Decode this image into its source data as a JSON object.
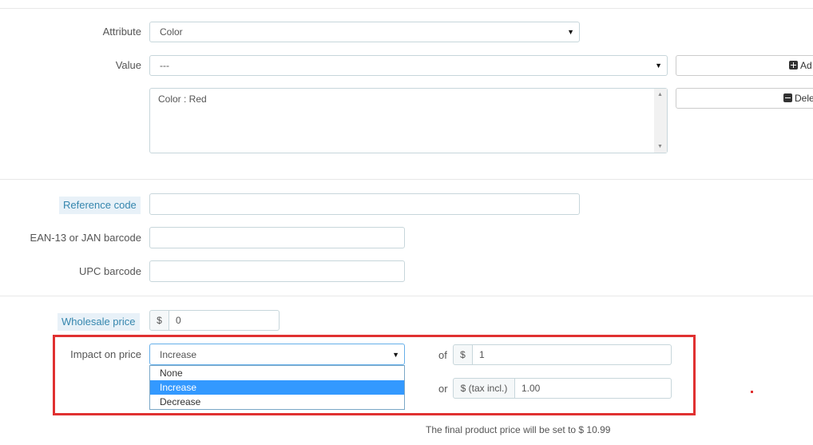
{
  "combination": {
    "attribute_label": "Attribute",
    "attribute_value": "Color",
    "value_label": "Value",
    "value_value": "---",
    "add_button": "Ad",
    "list_items": [
      "Color : Red"
    ],
    "delete_button": "Dele"
  },
  "codes": {
    "reference_label": "Reference code",
    "ean_label": "EAN-13 or JAN barcode",
    "upc_label": "UPC barcode"
  },
  "pricing": {
    "wholesale_label": "Wholesale price",
    "wholesale_currency": "$",
    "wholesale_value": "0",
    "impact_label": "Impact on price",
    "impact_selected": "Increase",
    "impact_options": [
      "None",
      "Increase",
      "Decrease"
    ],
    "of_label": "of",
    "of_currency": "$",
    "of_value": "1",
    "or_label": "or",
    "or_currency": "$ (tax incl.)",
    "or_value": "1.00",
    "final_price_text": "The final product price will be set to $ 10.99"
  },
  "colors": {
    "highlight_border": "#e03131",
    "selected_option": "#3399ff",
    "label_highlight_bg": "#e8f1f8"
  }
}
